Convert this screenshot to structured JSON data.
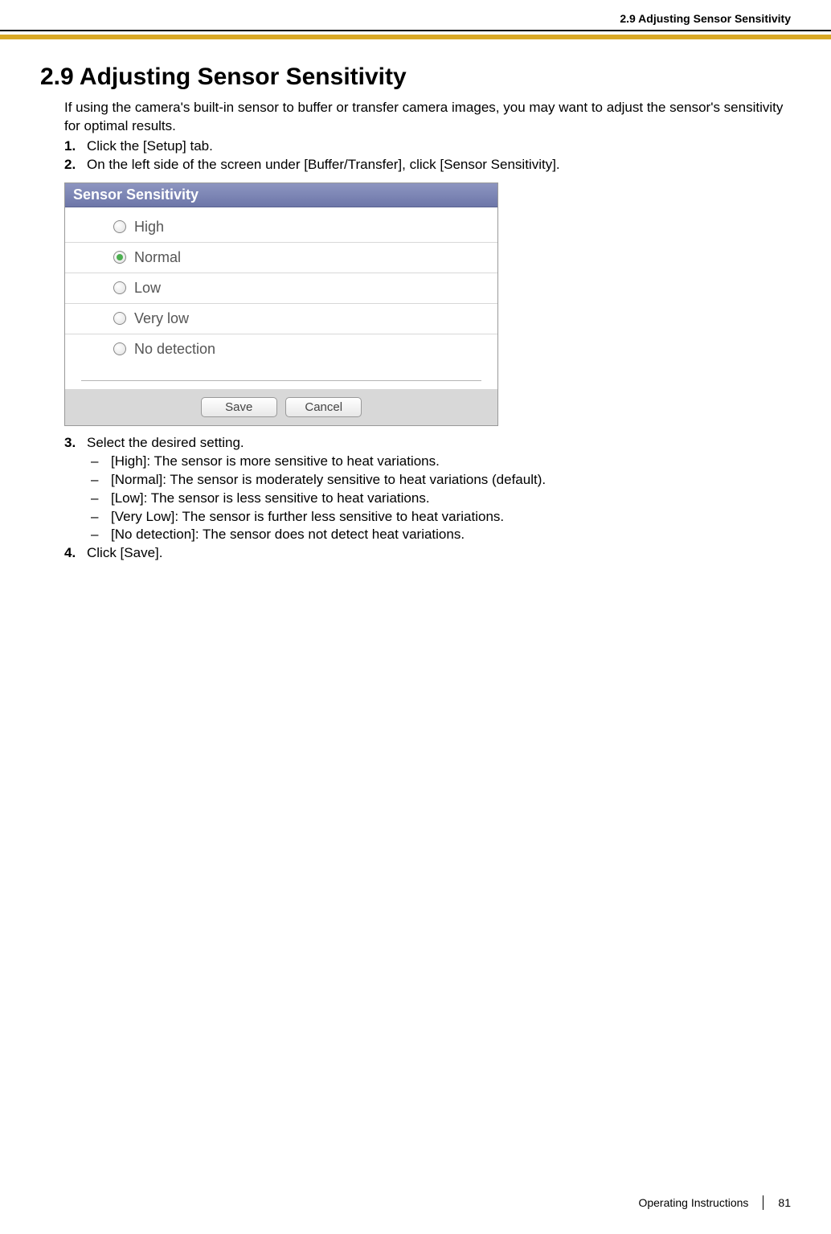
{
  "header": {
    "breadcrumb": "2.9 Adjusting Sensor Sensitivity"
  },
  "title": "2.9  Adjusting Sensor Sensitivity",
  "intro": "If using the camera's built-in sensor to buffer or transfer camera images, you may want to adjust the sensor's sensitivity for optimal results.",
  "steps": {
    "s1": {
      "num": "1.",
      "text": "Click the [Setup] tab."
    },
    "s2": {
      "num": "2.",
      "text": "On the left side of the screen under [Buffer/Transfer], click [Sensor Sensitivity]."
    },
    "s3": {
      "num": "3.",
      "text": "Select the desired setting."
    },
    "s4": {
      "num": "4.",
      "text": "Click [Save]."
    }
  },
  "panel": {
    "title": "Sensor Sensitivity",
    "options": {
      "high": "High",
      "normal": "Normal",
      "low": "Low",
      "verylow": "Very low",
      "nodetect": "No detection"
    },
    "selected": "normal",
    "buttons": {
      "save": "Save",
      "cancel": "Cancel"
    }
  },
  "descriptions": {
    "high": "[High]: The sensor is more sensitive to heat variations.",
    "normal": "[Normal]: The sensor is moderately sensitive to heat variations (default).",
    "low": "[Low]: The sensor is less sensitive to heat variations.",
    "verylow": "[Very Low]: The sensor is further less sensitive to heat variations.",
    "nodetect": "[No detection]: The sensor does not detect heat variations."
  },
  "footer": {
    "doc": "Operating Instructions",
    "page": "81"
  }
}
